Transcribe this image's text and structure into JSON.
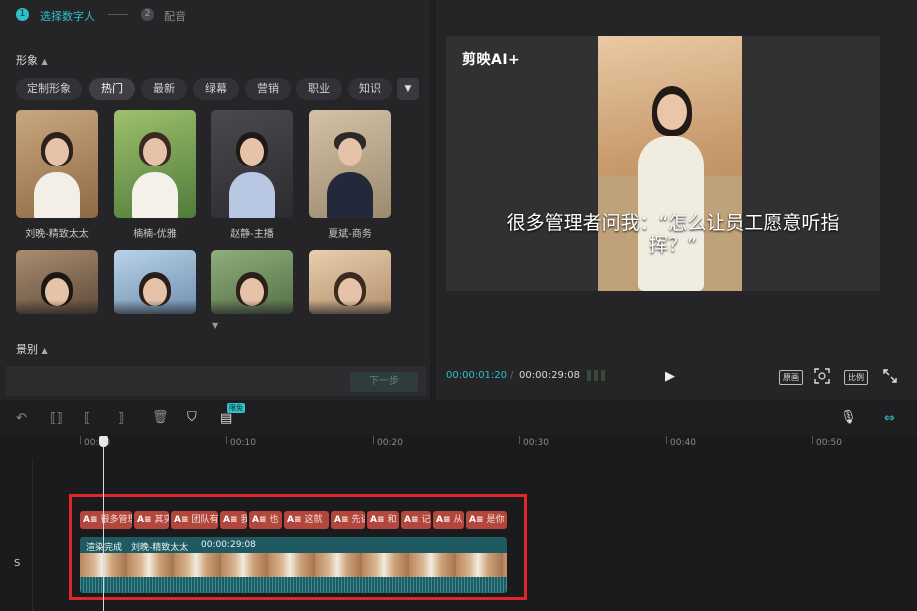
{
  "steps": [
    {
      "num": "1",
      "label": "选择数字人"
    },
    {
      "num": "2",
      "label": "配音"
    }
  ],
  "section_appearance": "形象",
  "filter_chips": [
    "定制形象",
    "热门",
    "最新",
    "绿幕",
    "营销",
    "职业",
    "知识"
  ],
  "avatars": [
    {
      "label": "刘晚-精致太太"
    },
    {
      "label": "楠楠-优雅"
    },
    {
      "label": "赵静-主播"
    },
    {
      "label": "夏斌-商务"
    },
    {
      "label": ""
    },
    {
      "label": ""
    },
    {
      "label": ""
    },
    {
      "label": ""
    }
  ],
  "section_scene": "景别",
  "next_button": "下一步",
  "preview": {
    "logo": "剪映AI+",
    "subtitle": "很多管理者问我：“怎么让员工愿意听指挥？”",
    "current_time": "00:00:01:20",
    "total_time": "00:00:29:08",
    "btn_original": "原画",
    "btn_ratio": "比例"
  },
  "toolbar_badge": "限免",
  "ruler": [
    "00:00",
    "00:10",
    "00:20",
    "00:30",
    "00:40",
    "00:50"
  ],
  "track_label": "S",
  "subtitle_clips": [
    "很多管理",
    "其实",
    "团队有",
    "我",
    "也",
    "这就",
    "先讲",
    "和",
    "记",
    "从",
    "是你"
  ],
  "video_clip": {
    "status": "渲染完成",
    "name": "刘晚-精致太太",
    "duration": "00:00:29:08"
  },
  "colors": {
    "accent": "#2fc0c6",
    "subtitle_clip": "#b3473c",
    "video_clip": "#1f5a62",
    "highlight_box": "#e0262a"
  }
}
